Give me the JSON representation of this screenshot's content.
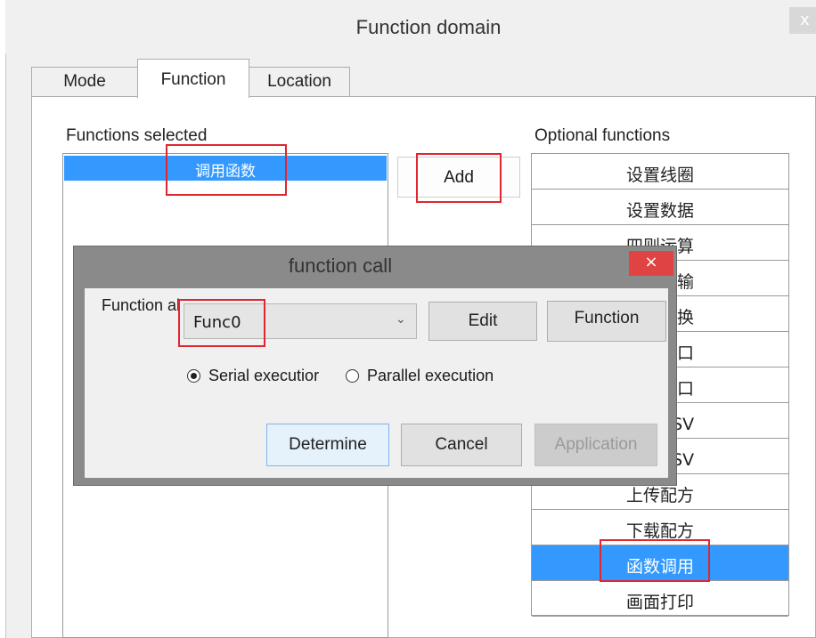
{
  "window": {
    "title": "Function domain",
    "close_glyph": "x"
  },
  "tabs": [
    {
      "label": "Mode"
    },
    {
      "label": "Function",
      "active": true
    },
    {
      "label": "Location"
    }
  ],
  "selected": {
    "label": "Functions selected",
    "items": [
      "调用函数"
    ]
  },
  "add_label": "Add",
  "optional": {
    "label": "Optional functions",
    "items": [
      "设置线圈",
      "设置数据",
      "四则运算",
      "数据传输",
      "数据转换",
      "打开窗口",
      "关闭窗口",
      "导入CSV",
      "导出CSV",
      "上传配方",
      "下载配方",
      "函数调用",
      "画面打印"
    ],
    "selected_index": 11
  },
  "dialog": {
    "title": "function call",
    "close_glyph": "×",
    "func_label": "Function al",
    "func_value": "Func0",
    "edit_label": "Edit",
    "function_label": "Function",
    "radio_serial": "Serial executior",
    "radio_parallel": "Parallel execution",
    "determine_label": "Determine",
    "cancel_label": "Cancel",
    "application_label": "Application"
  },
  "colors": {
    "selection": "#3399ff",
    "highlight": "#e0262f",
    "close": "#e04343"
  }
}
